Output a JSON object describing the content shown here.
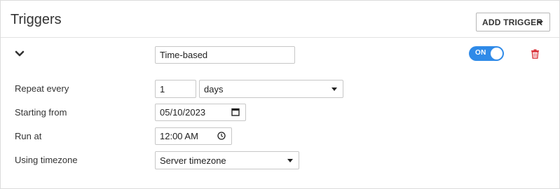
{
  "header": {
    "title": "Triggers",
    "add_trigger_label": "ADD TRIGGER"
  },
  "trigger": {
    "name": "Time-based",
    "toggle_label": "ON",
    "enabled": true
  },
  "form": {
    "repeat_label": "Repeat every",
    "repeat_value": "1",
    "repeat_unit": "days",
    "start_label": "Starting from",
    "start_value": "05/10/2023",
    "run_at_label": "Run at",
    "run_at_value": "12:00 AM",
    "timezone_label": "Using timezone",
    "timezone_value": "Server timezone"
  },
  "colors": {
    "toggle_on": "#2f8ae8",
    "delete": "#d9363e"
  },
  "icons": {
    "collapse": "chevron-down-icon",
    "delete": "trash-icon",
    "date": "calendar-icon",
    "time": "clock-icon",
    "dropdown": "caret-down-icon"
  }
}
